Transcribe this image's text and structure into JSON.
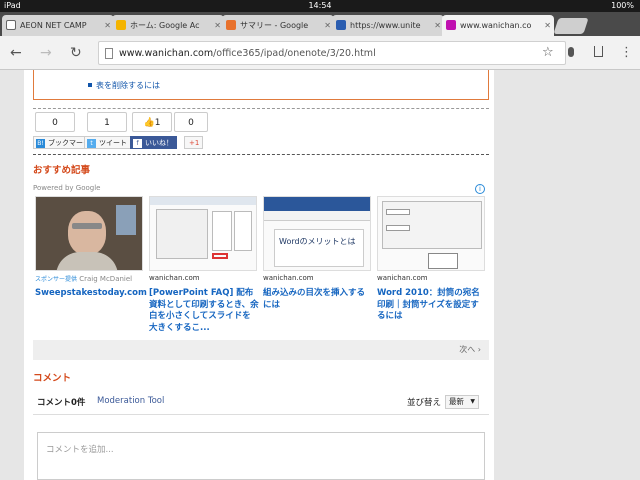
{
  "status": {
    "device": "iPad",
    "time": "14:54",
    "battery": "100%"
  },
  "tabs": [
    {
      "label": "AEON NET CAMP",
      "color": "#666666"
    },
    {
      "label": "ホーム: Google Ac",
      "color": "#f4b400"
    },
    {
      "label": "サマリー - Google",
      "color": "#e8712c"
    },
    {
      "label": "https://www.unite",
      "color": "#2a5db0"
    },
    {
      "label": "www.wanichan.co",
      "color": "#c010b0"
    }
  ],
  "toolbar": {
    "url_host": "www.wanichan.com",
    "url_path": "/office365/ipad/onenote/3/20.html"
  },
  "article": {
    "list_item": "表を削除するには"
  },
  "share": {
    "counts": [
      "0",
      "1",
      "1",
      "0"
    ],
    "bookmark": "ブックマーク",
    "tweet": "ツイート",
    "like": "いいね！",
    "gplus": "+1"
  },
  "recommend": {
    "heading": "おすすめ記事",
    "powered": "Powered by Google",
    "more": "次へ",
    "cards": [
      {
        "source": "Craig McDaniel",
        "sponsor": "スポンサー提供",
        "title": "Sweepstakestoday.com"
      },
      {
        "source": "wanichan.com",
        "title": "[PowerPoint FAQ] 配布資料として印刷するとき、余白を小さくしてスライドを大きくするこ..."
      },
      {
        "source": "wanichan.com",
        "title": "組み込みの目次を挿入するには"
      },
      {
        "source": "wanichan.com",
        "title": "Word 2010：封筒の宛名印刷｜封筒サイズを設定するには"
      }
    ],
    "thumb3_text": "Wordのメリットとは"
  },
  "comments": {
    "heading": "コメント",
    "count": "コメント0件",
    "moderation": "Moderation Tool",
    "sort_label": "並び替え",
    "sort_value": "最新",
    "placeholder": "コメントを追加..."
  }
}
